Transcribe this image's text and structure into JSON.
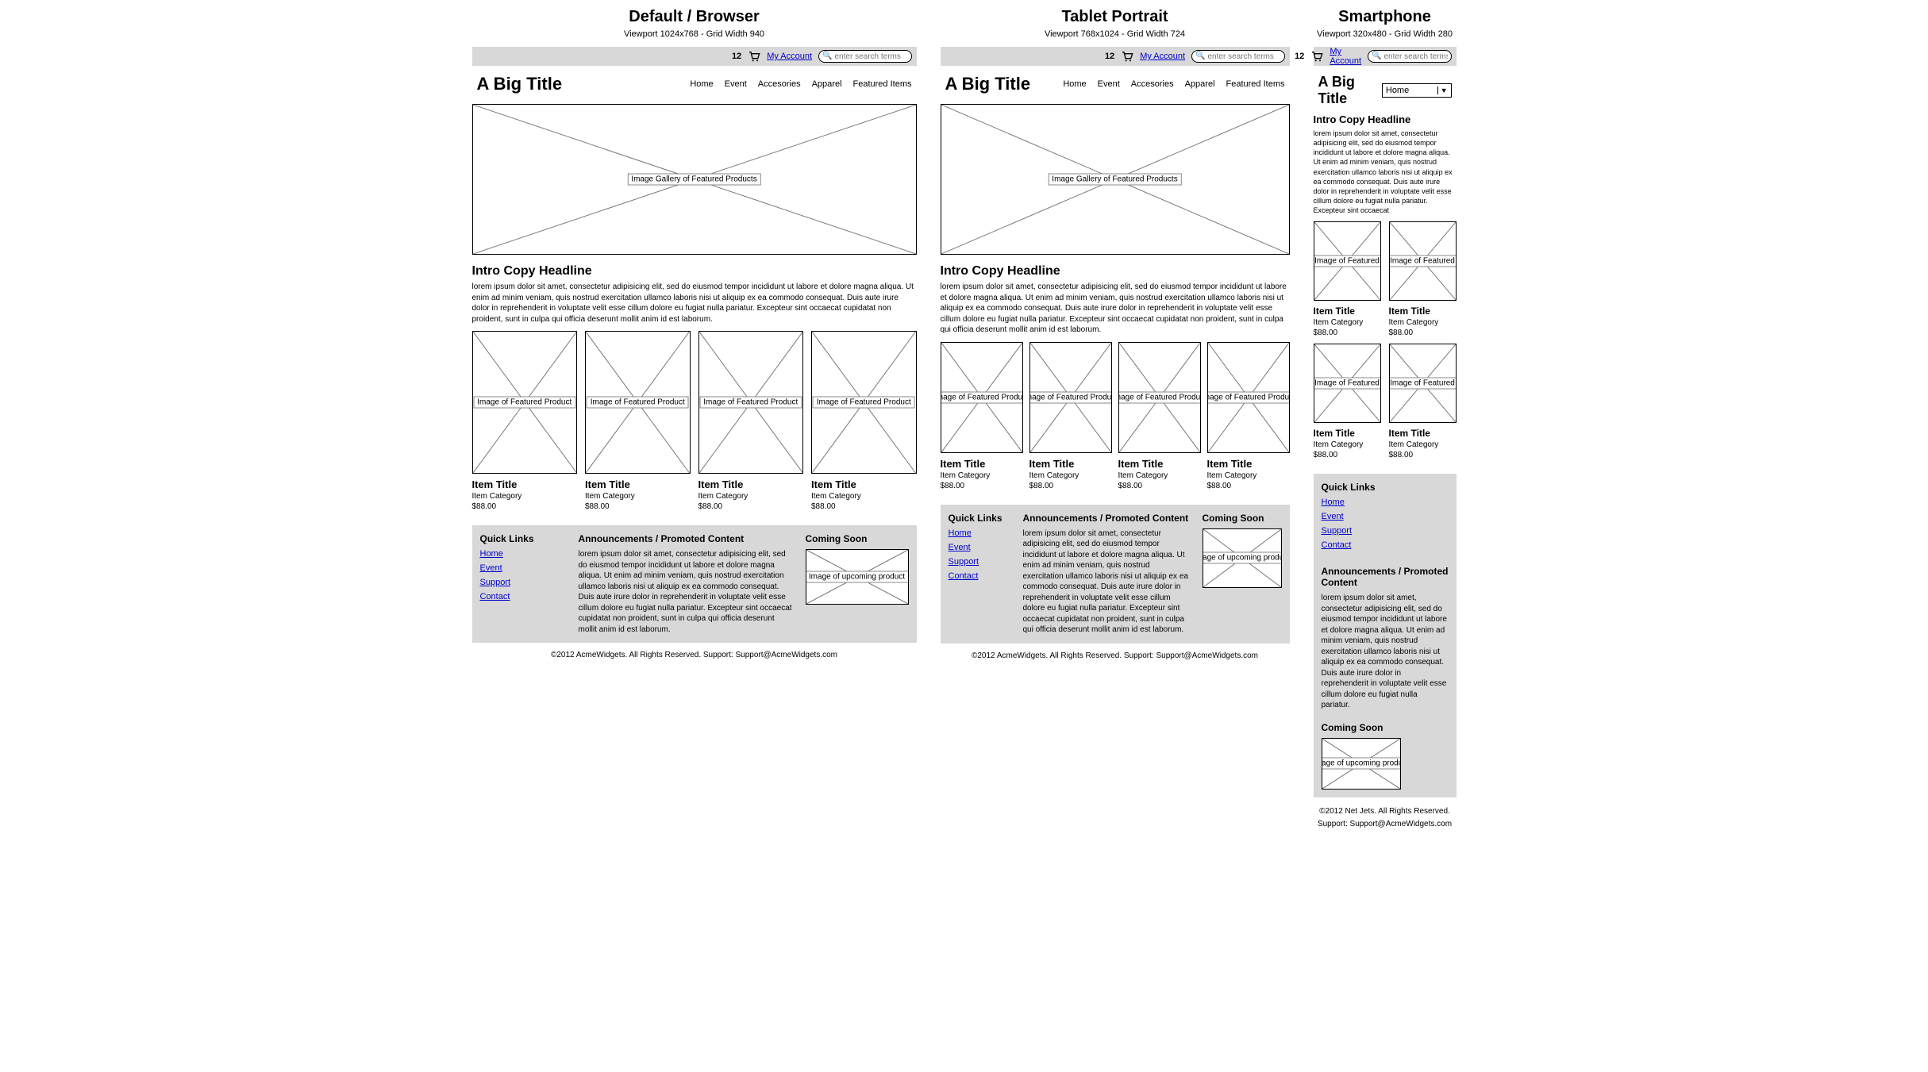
{
  "devices": {
    "desktop": {
      "name": "Default / Browser",
      "sub": "Viewport 1024x768 - Grid Width 940"
    },
    "tablet": {
      "name": "Tablet Portrait",
      "sub": "Viewport 768x1024 - Grid Width 724"
    },
    "phone": {
      "name": "Smartphone",
      "sub": "Viewport 320x480 - Grid Width 280"
    }
  },
  "topbar": {
    "cart_count": "12",
    "account": "My Account",
    "search_placeholder": "enter search terms"
  },
  "title": "A Big Title",
  "nav": [
    "Home",
    "Event",
    "Accesories",
    "Apparel",
    "Featured Items"
  ],
  "nav_select": "Home",
  "hero_label": "Image Gallery of Featured Products",
  "intro": {
    "h": "Intro Copy Headline",
    "p_long": "lorem ipsum dolor sit amet, consectetur adipisicing elit, sed do eiusmod tempor incididunt ut labore et dolore magna aliqua. Ut enim ad minim veniam, quis nostrud exercitation ullamco laboris nisi ut aliquip ex ea commodo consequat. Duis aute irure dolor in reprehenderit in voluptate velit esse cillum dolore eu fugiat nulla pariatur. Excepteur sint occaecat cupidatat non proident, sunt in culpa qui officia deserunt mollit anim id est laborum.",
    "p_phone": "lorem ipsum dolor sit amet, consectetur adipisicing elit, sed do eiusmod tempor incididunt ut labore et dolore magna aliqua. Ut enim ad minim veniam, quis nostrud exercitation ullamco laboris nisi ut aliquip ex ea commodo consequat. Duis aute irure dolor in reprehenderit in voluptate velit esse cillum dolore eu fugiat nulla pariatur. Excepteur sint occaecat"
  },
  "card": {
    "img_label_long": "Image of Featured Product",
    "img_label_short": "Image of Featured",
    "title": "Item Title",
    "category": "Item Category",
    "price": "$88.00"
  },
  "footer": {
    "quick_h": "Quick Links",
    "links": [
      "Home",
      "Event",
      "Support",
      "Contact"
    ],
    "ann_h": "Announcements / Promoted Content",
    "ann_p": "lorem ipsum dolor sit amet, consectetur adipisicing elit, sed do eiusmod tempor incididunt ut labore et dolore magna aliqua. Ut enim ad minim veniam, quis nostrud exercitation ullamco laboris nisi ut aliquip ex ea commodo consequat. Duis aute irure dolor in reprehenderit in voluptate velit esse cillum dolore eu fugiat nulla pariatur. Excepteur sint occaecat cupidatat non proident, sunt in culpa qui officia deserunt mollit anim id est laborum.",
    "ann_p_phone": "lorem ipsum dolor sit amet, consectetur adipisicing elit, sed do eiusmod tempor incididunt ut labore et dolore magna aliqua. Ut enim ad minim veniam, quis nostrud exercitation ullamco laboris nisi ut aliquip ex ea commodo consequat. Duis aute irure dolor in reprehenderit in voluptate velit esse cillum dolore eu fugiat nulla pariatur.",
    "soon_h": "Coming Soon",
    "soon_label": "Image of upcoming product"
  },
  "copyright_main": "©2012 AcmeWidgets.   All Rights Reserved.   Support: Support@AcmeWidgets.com",
  "copyright_phone_1": "©2012 Net Jets.   All Rights Reserved.",
  "copyright_phone_2": "Support: Support@AcmeWidgets.com"
}
